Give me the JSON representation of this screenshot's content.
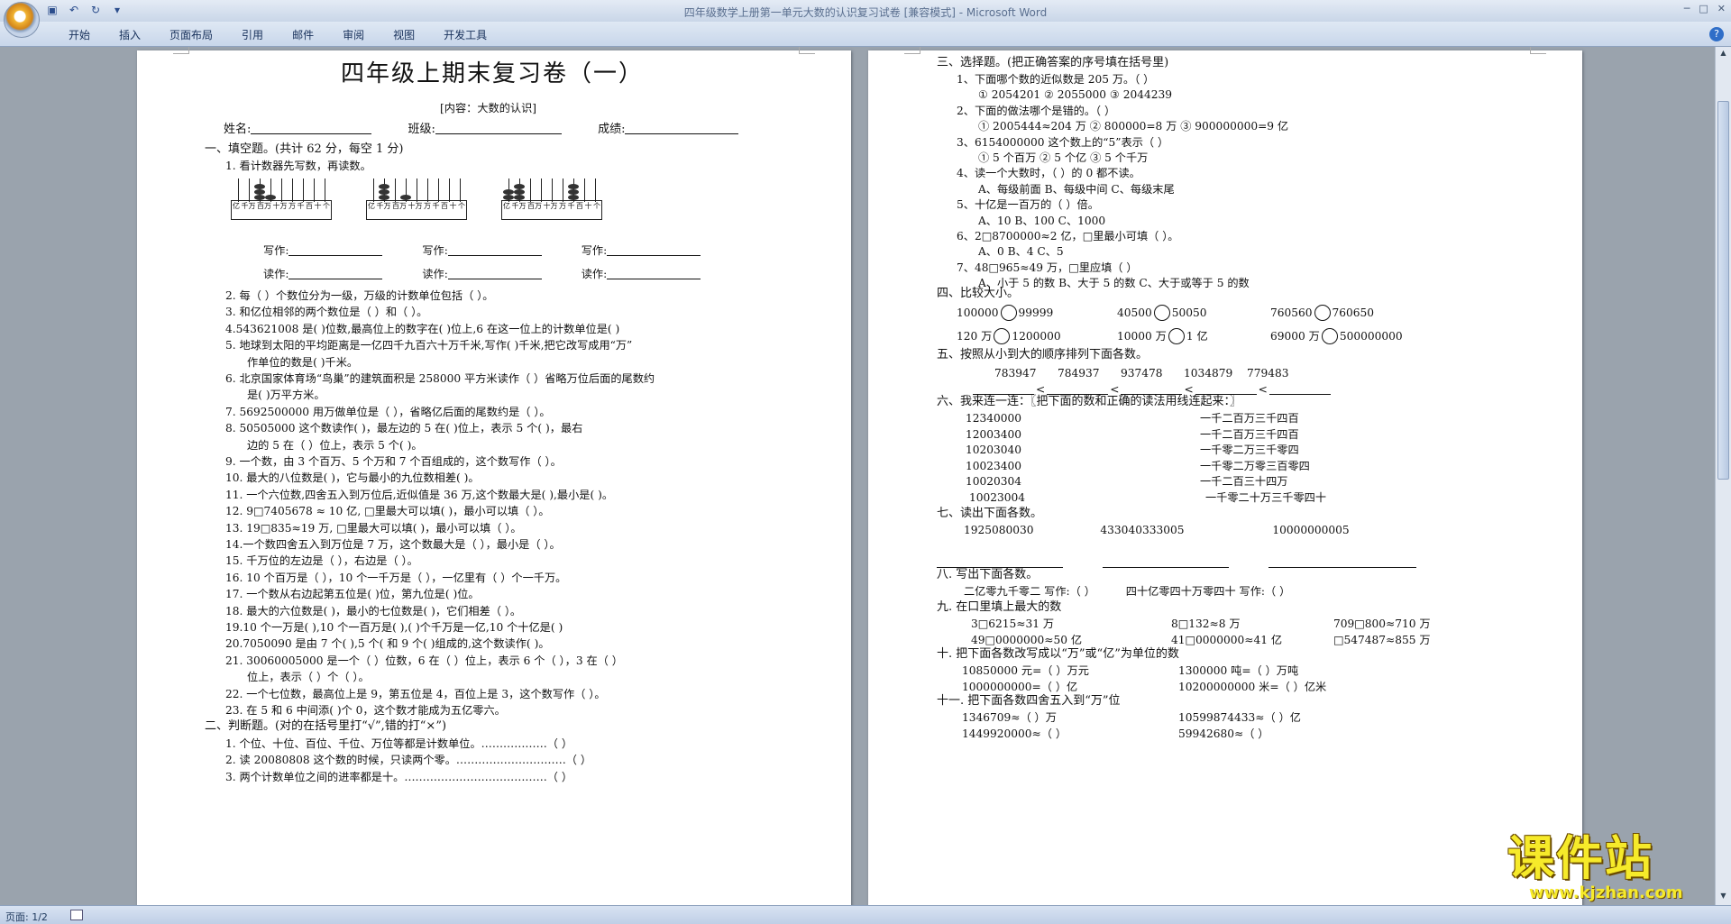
{
  "window": {
    "title": "四年级数学上册第一单元大数的认识复习试卷 [兼容模式] - Microsoft Word",
    "tabs": [
      "开始",
      "插入",
      "页面布局",
      "引用",
      "邮件",
      "审阅",
      "视图",
      "开发工具"
    ],
    "status": "页面: 1/2"
  },
  "watermark": {
    "text": "课件站",
    "url": "www.kjzhan.com"
  },
  "page1": {
    "title": "四年级上期末复习卷（一）",
    "subtitle": "[内容：大数的认识]",
    "name_row": {
      "name": "姓名:",
      "class": "班级:",
      "score": "成绩:"
    },
    "sec1": "一、填空题。(共计 62 分，每空 1 分)",
    "q1": "1. 看计数器先写数，再读数。",
    "abacus_labels": [
      "亿",
      "千万",
      "百万",
      "十万",
      "万",
      "千",
      "百",
      "十",
      "个"
    ],
    "write": "写作:",
    "read": "读作:",
    "lines": [
      "2. 每（        ）个数位分为一级，万级的计数单位包括（                               ）。",
      "3. 和亿位相邻的两个数位是（          ）和（          ）。",
      "4.543621008 是(       )位数,最高位上的数字在(       )位上,6 在这一位上的计数单位是(       )",
      "5. 地球到太阳的平均距离是一亿四千九百六十万千米,写作(                )千米,把它改写成用“万”",
      "作单位的数是(          )千米。",
      "6. 北京国家体育场“鸟巢”的建筑面积是 258000 平方米读作（            ）省略万位后面的尾数约",
      "是(          )万平方米。",
      "7. 5692500000 用万做单位是（            ），省略亿后面的尾数约是（            ）。",
      "8. 50505000 这个数读作(                    )，最左边的 5 在(       )位上，表示 5 个(       )，最右",
      "边的 5 在（         ）位上，表示 5 个(          )。",
      "9. 一个数，由 3 个百万、5 个万和 7 个百组成的，这个数写作（                 ）。",
      "10. 最大的八位数是(             )，它与最小的九位数相差(           )。",
      "11. 一个六位数,四舍五入到万位后,近似值是 36 万,这个数最大是(              ),最小是(            )。",
      "12. 9□7405678 ≈ 10 亿, □里最大可以填(        )，最小可以填（        ）。",
      "13. 19□835≈19 万, □里最大可以填(        )，最小可以填（        ）。",
      "14.一个数四舍五入到万位是 7 万，这个数最大是（               ），最小是（           ）。",
      "15. 千万位的左边是（           ），右边是（           ）。",
      "16. 10 个百万是（          ），10 个一千万是（          ），一亿里有（        ）个一千万。",
      "17. 一个数从右边起第五位是(           )位，第九位是(          )位。",
      "18. 最大的六位数是(               )，最小的七位数是(               )，它们相差（         ）。",
      "19.10 个一万是(         ),10 个一百万是(         ),(         )个千万是一亿,10 个十亿是(          )",
      "20.7050090 是由 7 个(         ),5 个(         和 9 个(         )组成的,这个数读作(                      )。",
      "21. 30060005000 是一个（       ）位数，6 在（       ）位上，表示 6 个（         ），3 在（        ）",
      "位上，表示（       ）个（         ）。",
      "22. 一个七位数，最高位上是 9，第五位是 4，百位上是 3，这个数写作（                         ）。",
      "23. 在 5 和 6 中间添(          )个 0，这个数才能成为五亿零六。",
      "二、判断题。(对的在括号里打“√”,错的打“×”)",
      "1. 个位、十位、百位、千位、万位等都是计数单位。………………（      ）",
      "2. 读 20080808 这个数的时候，只读两个零。…………………………（      ）",
      "3. 两个计数单位之间的进率都是十。…………………………………（      ）"
    ]
  },
  "page2": {
    "sec3": "三、选择题。(把正确答案的序号填在括号里)",
    "lines": [
      "1、下面哪个数的近似数是 205 万。（           ）",
      "① 2054201                    ② 2055000                   ③ 2044239",
      "2、下面的做法哪个是错的。（        ）",
      "① 2005444≈204 万       ② 800000=8 万     ③  900000000=9 亿",
      "3、6154000000 这个数上的“5”表示（         ）",
      "① 5 个百万          ② 5 个亿          ③ 5 个千万",
      "4、读一个大数时，（      ）的 0 都不读。",
      "A、每级前面                B、每级中间                 C、每级末尾",
      "5、十亿是一百万的（      ）倍。",
      "A、10                          B、100                        C、1000",
      "6、2□8700000≈2 亿，□里最小可填（      ）。",
      "A、0                            B、4                            C、5",
      "7、48□965≈49 万，□里应填（          ）",
      "A、小于 5 的数            B、大于 5 的数               C、大于或等于 5 的数"
    ],
    "sec4": "四、比较大小。",
    "compare": [
      [
        "100000",
        "99999",
        "40500",
        "50050",
        "760560",
        "760650"
      ],
      [
        "120 万",
        "1200000",
        "10000 万",
        "1 亿",
        "69000 万",
        "500000000"
      ]
    ],
    "sec5": "五、按照从小到大的顺序排列下面各数。",
    "sort_nums": [
      "783947",
      "784937",
      "937478",
      "1034879",
      "779483"
    ],
    "sec6": "六、我来连一连：〖把下面的数和正确的读法用线连起来：〗",
    "match_left": [
      "12340000",
      "12003400",
      "10203040",
      "10023400",
      "10020304",
      "10023004"
    ],
    "match_right": [
      "一千二百万三千四百",
      "一千二百万三千四百",
      "一千零二万三千零四",
      "一千零二万零三百零四",
      "一千二百三十四万",
      "一千零二十万三千零四十"
    ],
    "sec7": "七、读出下面各数。",
    "read_nums": [
      "1925080030",
      "433040333005",
      "10000000005"
    ],
    "sec8": "八. 写出下面各数。",
    "write_nums": [
      "二亿零九千零二  写作:（                   ）",
      "四十亿零四十万零四十  写作:（                     ）"
    ],
    "sec9": "九. 在口里填上最大的数",
    "fill_max": [
      [
        "3□6215≈31 万",
        "8□132≈8 万",
        "709□800≈710 万"
      ],
      [
        "49□0000000≈50 亿",
        "41□0000000≈41 亿",
        "□547487≈855 万"
      ]
    ],
    "sec10": "十. 把下面各数改写成以“万”或“亿”为单位的数",
    "rewrite": [
      [
        "10850000 元=（            ）万元",
        "1300000 吨=（             ）万吨"
      ],
      [
        "1000000000=（            ）亿",
        "10200000000 米=（             ）亿米"
      ]
    ],
    "sec11": "十一. 把下面各数四舍五入到“万”位",
    "round": [
      [
        "1346709≈（              ）万",
        "10599874433≈（             ）亿"
      ],
      [
        "1449920000≈（              ）",
        "59942680≈（              ）"
      ]
    ]
  }
}
